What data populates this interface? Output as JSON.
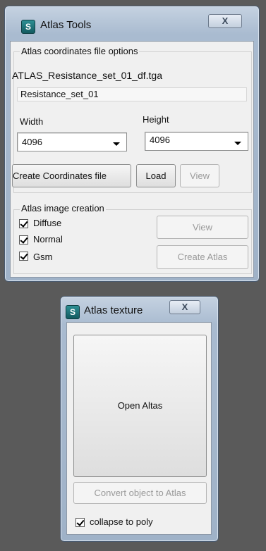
{
  "atlas_tools": {
    "title": "Atlas Tools",
    "close": "X",
    "coords_group": {
      "legend": "Atlas coordinates file options",
      "file_name": "ATLAS_Resistance_set_01_df.tga",
      "set_name": "Resistance_set_01",
      "width_label": "Width",
      "height_label": "Height",
      "width_value": "4096",
      "height_value": "4096",
      "create_button": "Create Coordinates file",
      "load_button": "Load",
      "view_button": "View"
    },
    "image_group": {
      "legend": "Atlas image creation",
      "checkboxes": [
        {
          "label": "Diffuse",
          "checked": true
        },
        {
          "label": "Normal",
          "checked": true
        },
        {
          "label": "Gsm",
          "checked": true
        }
      ],
      "view_button": "View",
      "create_atlas_button": "Create Atlas"
    }
  },
  "atlas_texture": {
    "title": "Atlas texture",
    "close": "X",
    "open_button": "Open Altas",
    "convert_button": "Convert object to Atlas",
    "collapse_label": "collapse to poly",
    "collapse_checked": true
  }
}
